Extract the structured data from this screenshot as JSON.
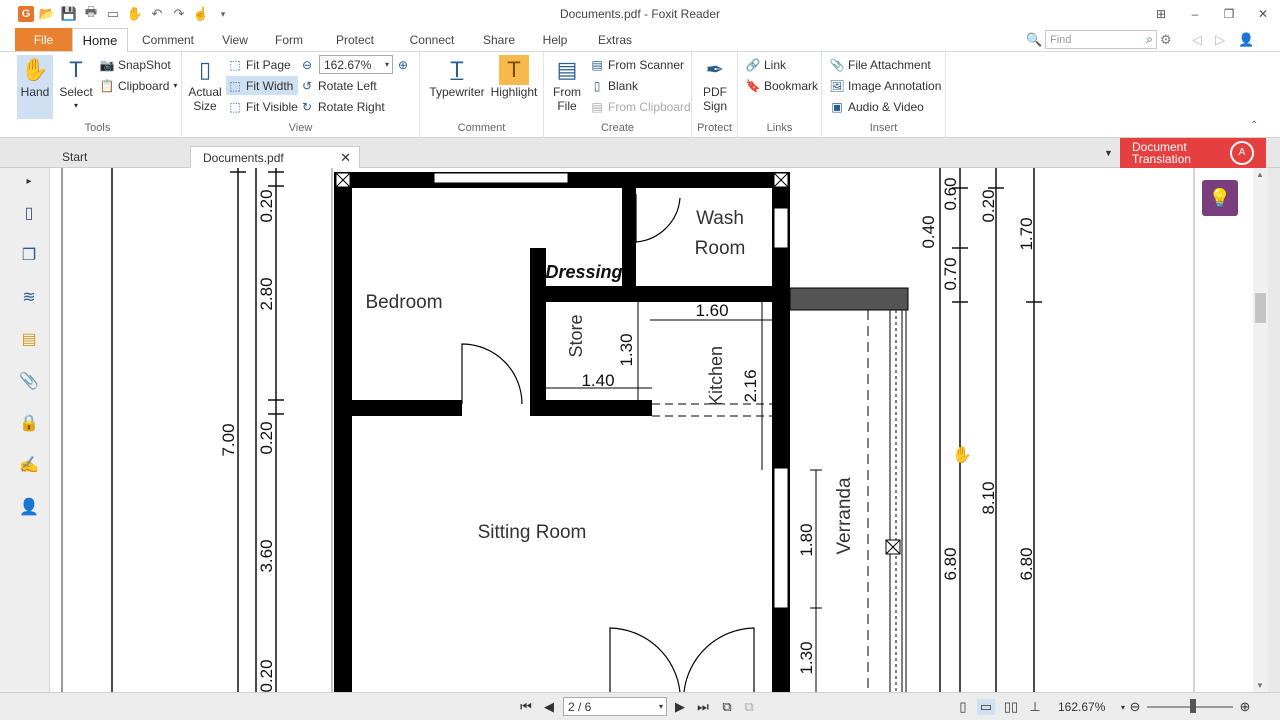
{
  "window": {
    "title": "Documents.pdf - Foxit Reader"
  },
  "menu": {
    "file": "File",
    "tabs": [
      "Home",
      "Comment",
      "View",
      "Form",
      "Protect",
      "Connect",
      "Share",
      "Help",
      "Extras"
    ],
    "active_tab": "Home",
    "find_placeholder": "Find"
  },
  "ribbon": {
    "tools": {
      "hand": "Hand",
      "select": "Select",
      "snapshot": "SnapShot",
      "clipboard": "Clipboard",
      "label": "Tools"
    },
    "view": {
      "actual_size_1": "Actual",
      "actual_size_2": "Size",
      "fit_page": "Fit Page",
      "fit_width": "Fit Width",
      "fit_visible": "Fit Visible",
      "zoom": "162.67%",
      "rotate_left": "Rotate Left",
      "rotate_right": "Rotate Right",
      "label": "View"
    },
    "comment": {
      "typewriter": "Typewriter",
      "highlight": "Highlight",
      "label": "Comment"
    },
    "create": {
      "from_file_1": "From",
      "from_file_2": "File",
      "from_scanner": "From Scanner",
      "blank": "Blank",
      "from_clipboard": "From Clipboard",
      "label": "Create"
    },
    "protect": {
      "pdf_sign_1": "PDF",
      "pdf_sign_2": "Sign",
      "label": "Protect"
    },
    "links": {
      "link": "Link",
      "bookmark": "Bookmark",
      "label": "Links"
    },
    "insert": {
      "file_attachment": "File Attachment",
      "image_annotation": "Image Annotation",
      "audio_video": "Audio & Video",
      "label": "Insert"
    }
  },
  "doc_tabs": {
    "start": "Start",
    "active": "Documents.pdf",
    "translation_1": "Document",
    "translation_2": "Translation"
  },
  "plan": {
    "rooms": {
      "wash_1": "Wash",
      "wash_2": "Room",
      "dressing": "Dressing",
      "bedroom": "Bedroom",
      "store": "Store",
      "kitchen": "Kitchen",
      "sitting": "Sitting Room",
      "verranda": "Verranda"
    },
    "dims": {
      "d_1_60": "1.60",
      "d_1_30a": "1.30",
      "d_1_40": "1.40",
      "d_2_16": "2.16",
      "d_1_80": "1.80",
      "d_1_30b": "1.30",
      "l_0_20a": "0.20",
      "l_2_80": "2.80",
      "l_0_20b": "0.20",
      "l_3_60": "3.60",
      "l_0_20c": "0.20",
      "l_7_00": "7.00",
      "r_0_40": "0.40",
      "r_0_60": "0.60",
      "r_0_70": "0.70",
      "r_6_80a": "6.80",
      "r_0_20": "0.20",
      "r_8_10": "8.10",
      "r_1_70": "1.70",
      "r_6_80b": "6.80"
    }
  },
  "status": {
    "page": "2 / 6",
    "zoom": "162.67%"
  }
}
